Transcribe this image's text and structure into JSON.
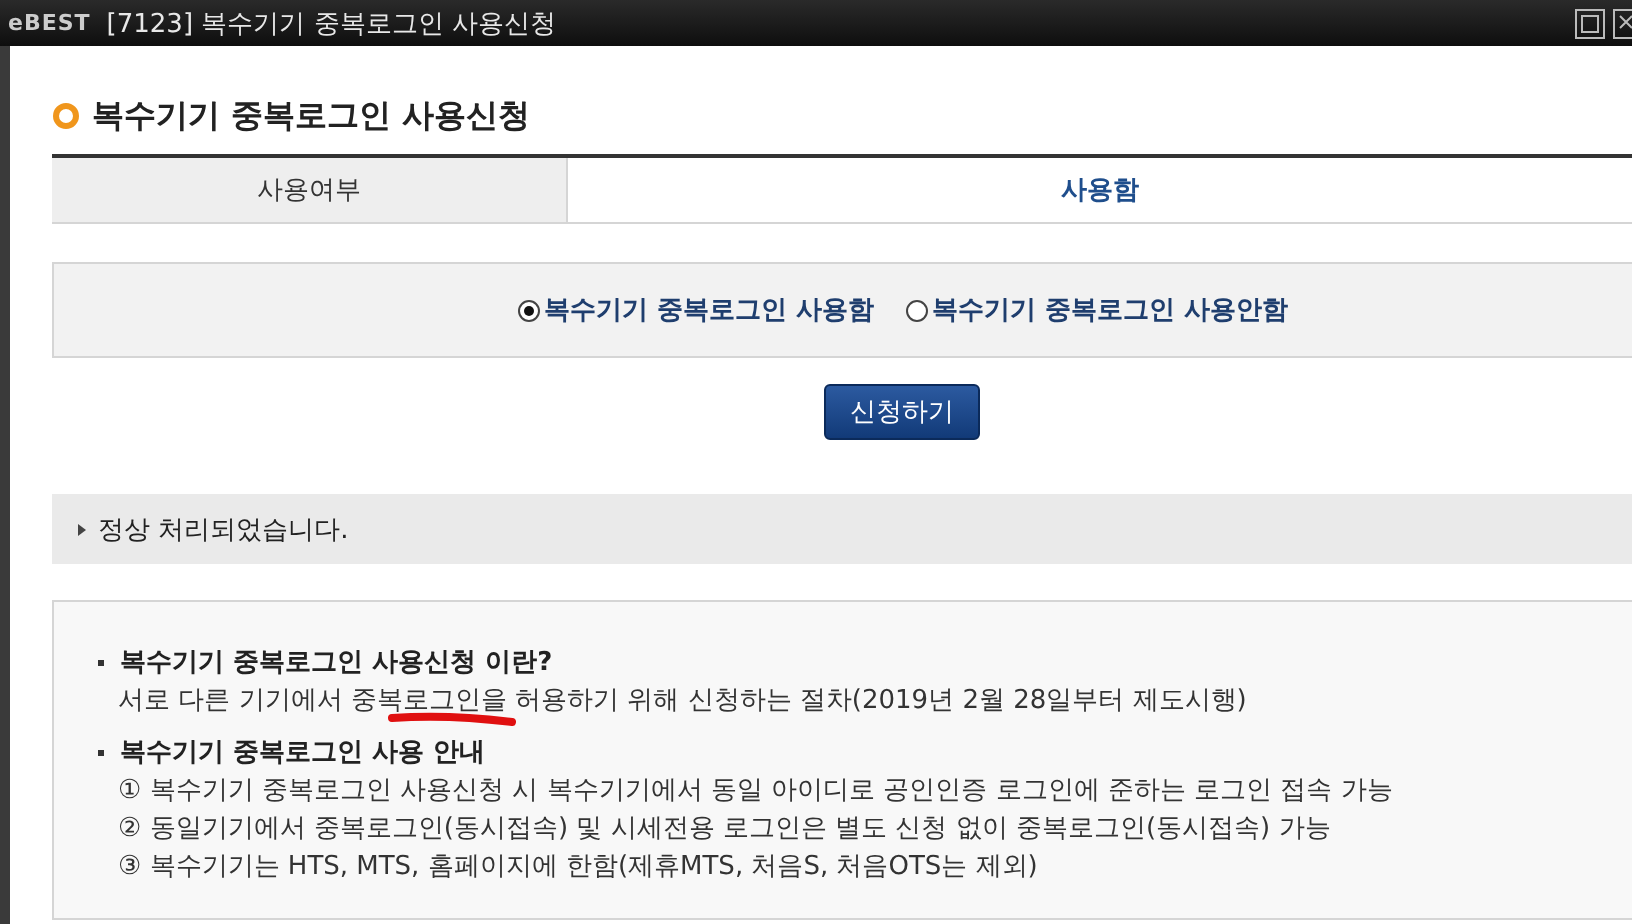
{
  "window": {
    "logo": "eBEST",
    "title": "[7123] 복수기기 중복로그인 사용신청"
  },
  "heading": "복수기기 중복로그인 사용신청",
  "usage_row": {
    "label": "사용여부",
    "value": "사용함"
  },
  "options": [
    {
      "label": "복수기기 중복로그인 사용함",
      "selected": true
    },
    {
      "label": "복수기기 중복로그인 사용안함",
      "selected": false
    }
  ],
  "apply_button": "신청하기",
  "message": "정상 처리되었습니다.",
  "info": [
    {
      "title": "복수기기 중복로그인 사용신청 이란?",
      "lines": [
        "서로 다른 기기에서 중복로그인을 허용하기 위해 신청하는 절차(2019년 2월 28일부터 제도시행)"
      ]
    },
    {
      "title": "복수기기 중복로그인 사용 안내",
      "lines": [
        "① 복수기기 중복로그인 사용신청 시 복수기기에서 동일 아이디로 공인인증 로그인에 준하는 로그인 접속 가능",
        "② 동일기기에서 중복로그인(동시접속) 및 시세전용 로그인은 별도 신청 없이 중복로그인(동시접속) 가능",
        "③ 복수기기는 HTS, MTS, 홈페이지에 한함(제휴MTS, 처음S, 처음OTS는 제외)"
      ]
    }
  ]
}
